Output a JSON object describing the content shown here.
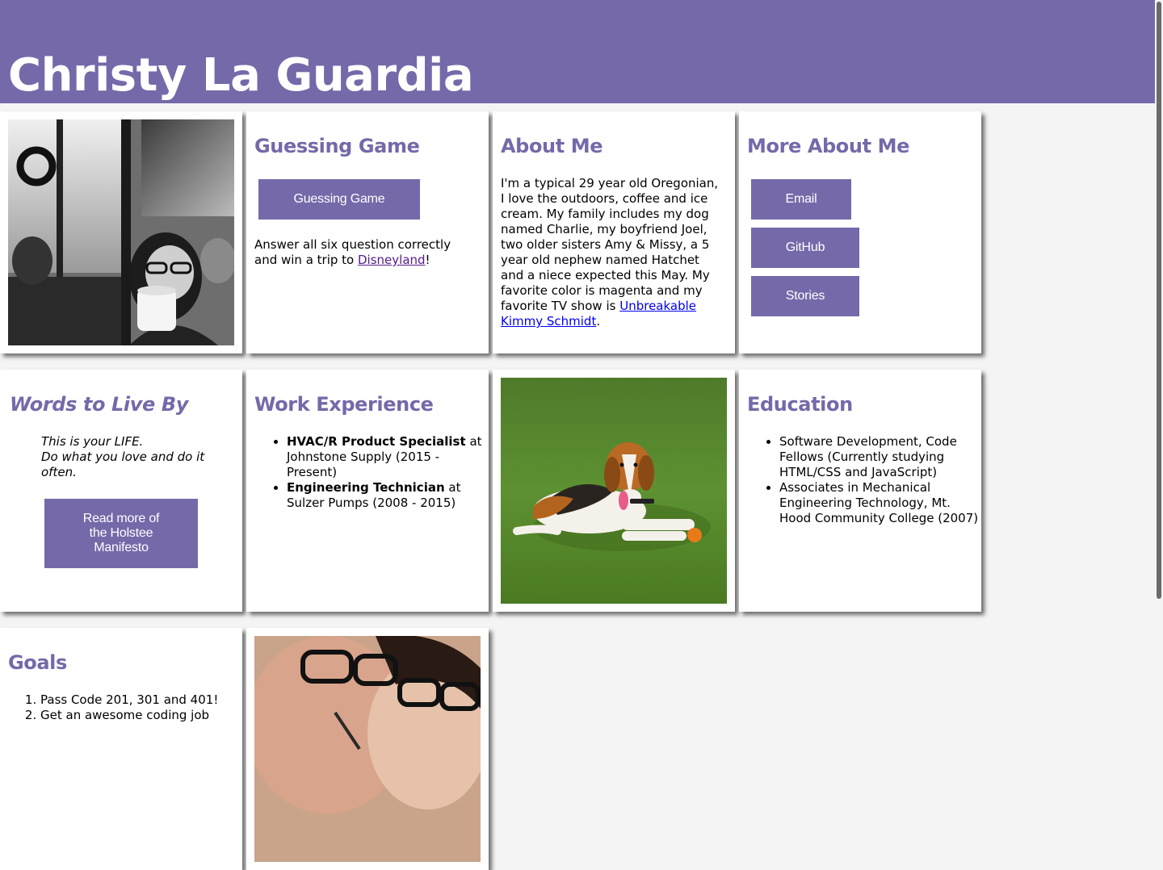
{
  "header": {
    "title": "Christy La Guardia"
  },
  "guessing_game": {
    "title": "Guessing Game",
    "button_label": "Guessing Game",
    "text_before": "Answer all six question correctly and win a trip to ",
    "link_text": "Disneyland",
    "text_after": "!"
  },
  "about_me": {
    "title": "About Me",
    "text_before": "I'm a typical 29 year old Oregonian, I love the outdoors, coffee and ice cream. My family includes my dog named Charlie, my boyfriend Joel, two older sisters Amy & Missy, a 5 year old nephew named Hatchet and a niece expected this May. My favorite color is magenta and my favorite TV show is ",
    "link_text": "Unbreakable Kimmy Schmidt",
    "text_after": "."
  },
  "more_about_me": {
    "title": "More About Me",
    "buttons": [
      "Email",
      "GitHub",
      "Stories"
    ]
  },
  "words": {
    "title": "Words to Live By",
    "quote_line1": "This is your LIFE.",
    "quote_line2": "Do what you love and do it often.",
    "button_label": "Read more of the Holstee Manifesto"
  },
  "work": {
    "title": "Work Experience",
    "items": [
      {
        "role": "HVAC/R Product Specialist",
        "rest": " at Johnstone Supply (2015 - Present)"
      },
      {
        "role": "Engineering Technician",
        "rest": " at Sulzer Pumps (2008 - 2015)"
      }
    ]
  },
  "education": {
    "title": "Education",
    "items": [
      "Software Development, Code Fellows (Currently studying HTML/CSS and JavaScript)",
      "Associates in Mechanical Engineering Technology, Mt. Hood Community College (2007)"
    ]
  },
  "goals": {
    "title": "Goals",
    "items": [
      "Pass Code 201, 301 and 401!",
      "Get an awesome coding job"
    ]
  },
  "colors": {
    "accent": "#7569a9",
    "background": "#f4f4f4"
  }
}
